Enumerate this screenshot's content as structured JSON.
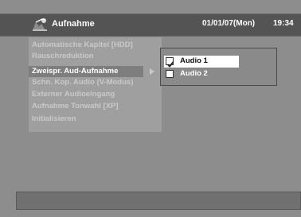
{
  "header": {
    "icon": "recording-icon",
    "title": "Aufnahme",
    "date": "01/01/07(Mon)",
    "time": "19:34"
  },
  "menu": {
    "items": [
      {
        "label": "Automatische Kapitel [HDD]"
      },
      {
        "label": "Rauschreduktion"
      },
      {
        "label": "Zweispr. Aud-Aufnahme",
        "selected": true
      },
      {
        "label": "Schn. Kop. Audio (V-Modus)"
      },
      {
        "label": "Externer Audioeingang"
      },
      {
        "label": "Aufnahme Tonwahl [XP]"
      },
      {
        "label": "Initialisieren"
      }
    ]
  },
  "submenu": {
    "items": [
      {
        "label": "Audio 1",
        "checked": true,
        "selected": true
      },
      {
        "label": "Audio 2",
        "checked": false,
        "selected": false
      }
    ]
  },
  "colors": {
    "background": "#8d8d8d",
    "title_bar": "#545454",
    "menu_panel": "#9f9f9f",
    "selected_row": "#7e7e7e",
    "submenu_panel": "#8a8a8a"
  }
}
